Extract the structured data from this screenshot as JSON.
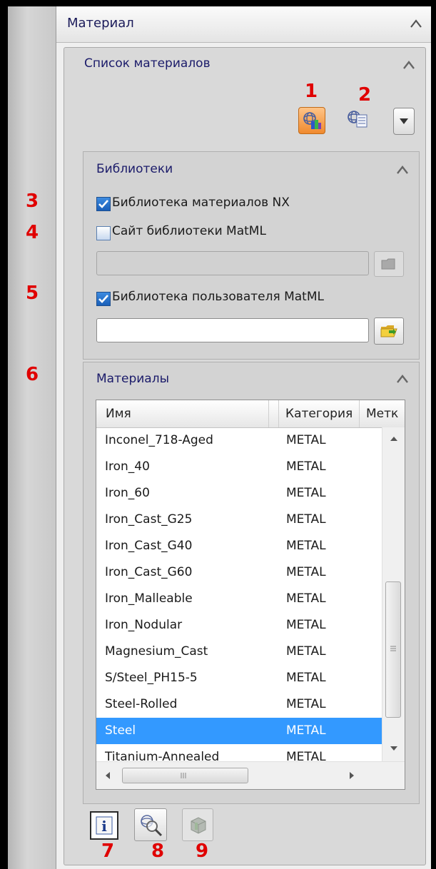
{
  "panel": {
    "title": "Материал"
  },
  "material_list": {
    "title": "Список материалов"
  },
  "libraries": {
    "title": "Библиотеки",
    "nx_library": {
      "label": "Библиотека материалов NX",
      "checked": true
    },
    "matml_site": {
      "label": "Сайт библиотеки MatML",
      "checked": false,
      "value": ""
    },
    "matml_user": {
      "label": "Библиотека пользователя MatML",
      "checked": true,
      "value": ""
    }
  },
  "materials": {
    "title": "Материалы",
    "columns": [
      "Имя",
      "Категория",
      "Метк"
    ],
    "rows": [
      {
        "name": "Inconel_718-Aged",
        "category": "METAL"
      },
      {
        "name": "Iron_40",
        "category": "METAL"
      },
      {
        "name": "Iron_60",
        "category": "METAL"
      },
      {
        "name": "Iron_Cast_G25",
        "category": "METAL"
      },
      {
        "name": "Iron_Cast_G40",
        "category": "METAL"
      },
      {
        "name": "Iron_Cast_G60",
        "category": "METAL"
      },
      {
        "name": "Iron_Malleable",
        "category": "METAL"
      },
      {
        "name": "Iron_Nodular",
        "category": "METAL"
      },
      {
        "name": "Magnesium_Cast",
        "category": "METAL"
      },
      {
        "name": "S/Steel_PH15-5",
        "category": "METAL"
      },
      {
        "name": "Steel-Rolled",
        "category": "METAL"
      },
      {
        "name": "Steel",
        "category": "METAL",
        "selected": true
      },
      {
        "name": "Titanium-Annealed",
        "category": "METAL"
      }
    ],
    "selected_name": "Steel"
  },
  "annotations": {
    "n1": "1",
    "n2": "2",
    "n3": "3",
    "n4": "4",
    "n5": "5",
    "n6": "6",
    "n7": "7",
    "n8": "8",
    "n9": "9"
  },
  "colors": {
    "selection": "#3399ff",
    "annotation": "#e00000",
    "group_title": "#1b1b6a",
    "active_tool": "#f5a04a"
  },
  "icons": {
    "collapse": "chevron-up-icon",
    "tool1": "materials-library-icon",
    "tool2": "material-list-icon",
    "dropdown": "chevron-down-icon",
    "browse_disabled": "folder-icon",
    "browse": "open-folder-icon",
    "info": "info-icon",
    "inspect": "magnify-icon",
    "assign": "solid-cube-icon"
  }
}
